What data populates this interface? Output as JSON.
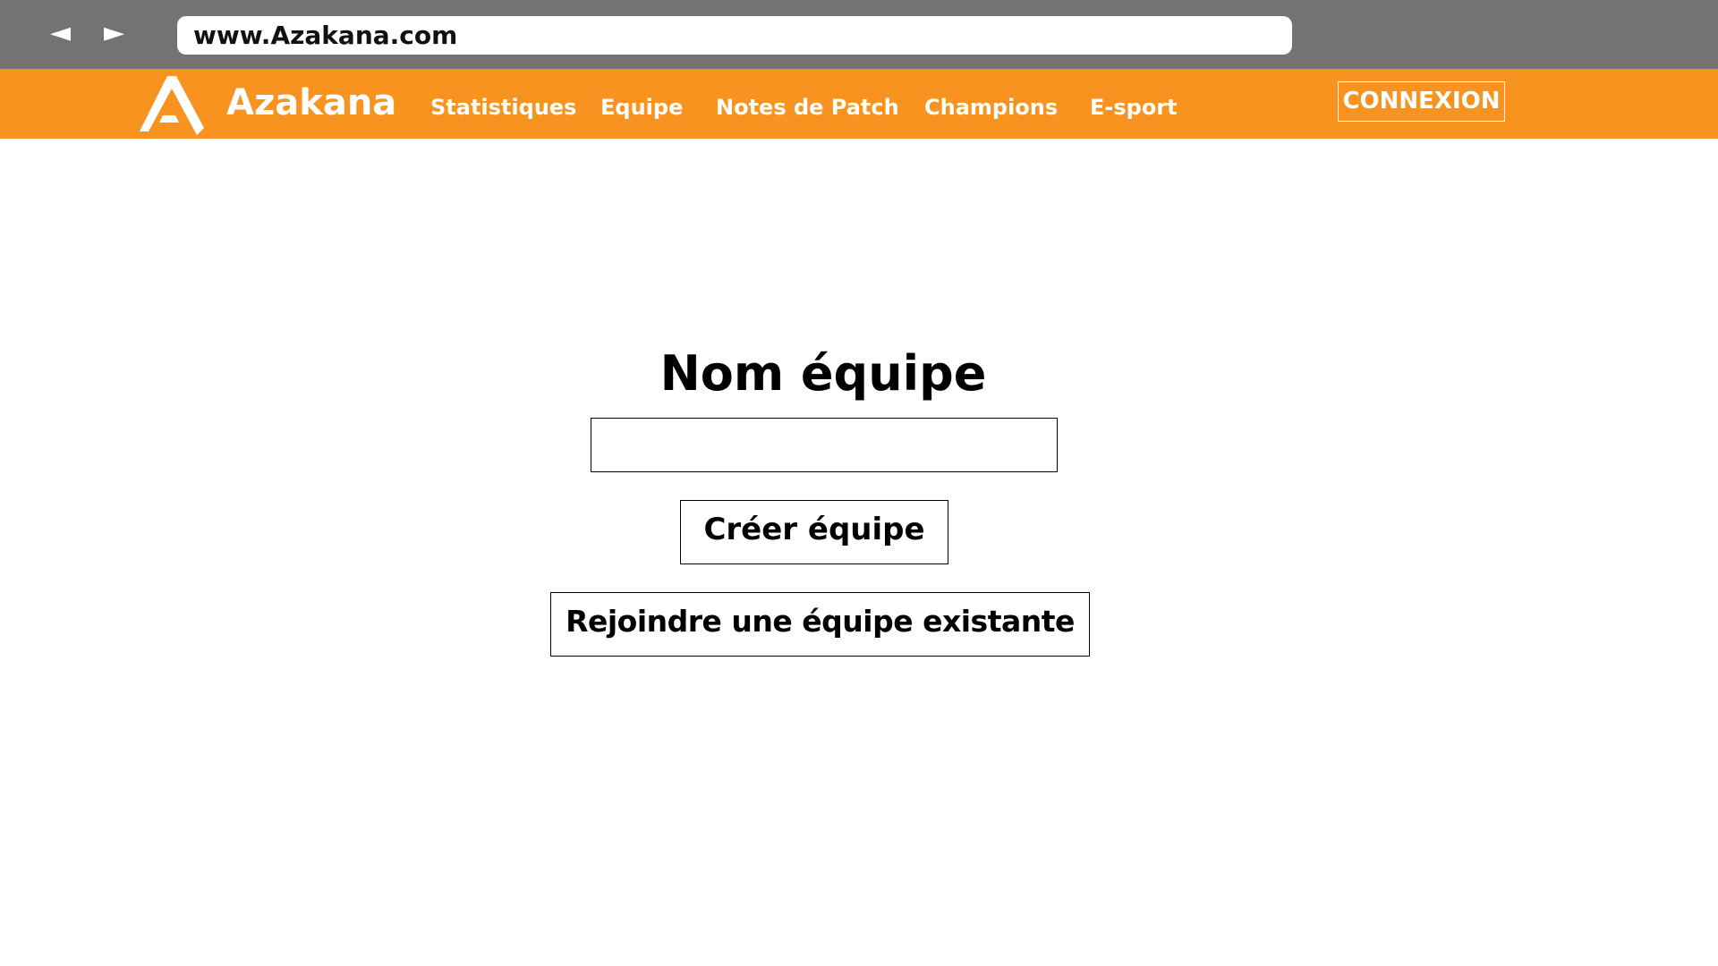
{
  "browser": {
    "back_icon": "back-arrow-icon",
    "forward_icon": "forward-arrow-icon",
    "back_glyph": "◄",
    "forward_glyph": "►",
    "url": "www.Azakana.com"
  },
  "nav": {
    "background": "#f7931e",
    "logo_icon": "azakana-logo-icon",
    "brand": "Azakana",
    "links": [
      "Statistiques",
      "Equipe",
      "Notes de Patch",
      "Champions",
      "E-sport"
    ],
    "login_label": "CONNEXION"
  },
  "main": {
    "title": "Nom équipe",
    "team_name_value": "",
    "create_label": "Créer équipe",
    "join_label": "Rejoindre une équipe  existante"
  }
}
